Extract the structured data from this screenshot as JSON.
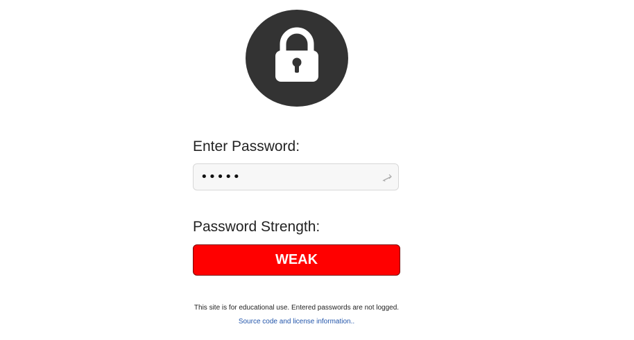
{
  "lock": {
    "icon": "lock-icon",
    "circle_color": "#333333"
  },
  "password": {
    "label": "Enter Password:",
    "masked_value": "•••••",
    "icon": "key-icon"
  },
  "strength": {
    "label": "Password Strength:",
    "value": "WEAK",
    "color": "#ff0000"
  },
  "footer": {
    "disclaimer": "This site is for educational use. Entered passwords are not logged.",
    "source_link": "Source code and license information.."
  }
}
